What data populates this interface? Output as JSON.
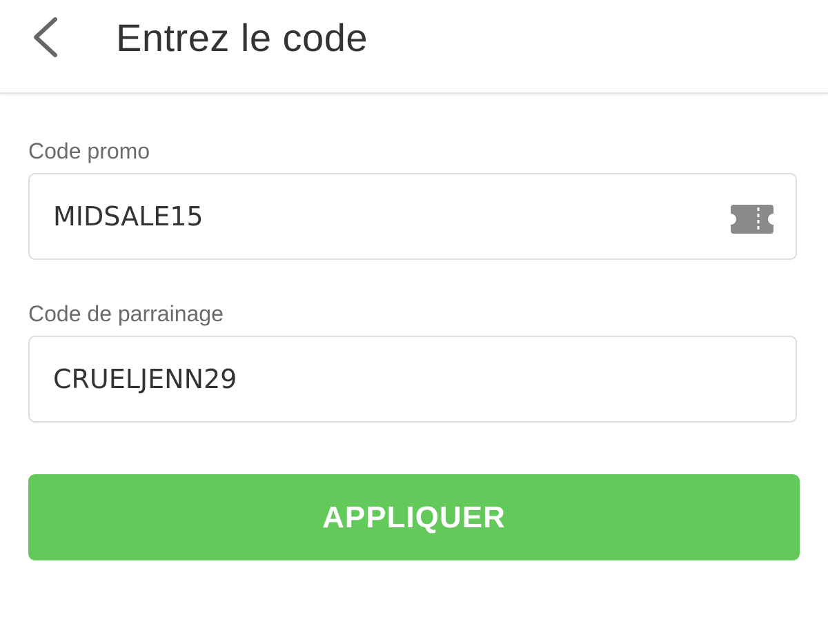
{
  "header": {
    "title": "Entrez le code",
    "back_icon": "chevron-left-icon"
  },
  "promo": {
    "label": "Code promo",
    "value": "MIDSALE15",
    "icon": "ticket-icon"
  },
  "referral": {
    "label": "Code de parrainage",
    "value": "CRUELJENN29"
  },
  "apply_button": {
    "label": "APPLIQUER"
  },
  "colors": {
    "accent": "#63c95b",
    "text": "#333333",
    "label": "#6b6b6b",
    "border": "#dedede",
    "icon": "#8a8a8a"
  }
}
